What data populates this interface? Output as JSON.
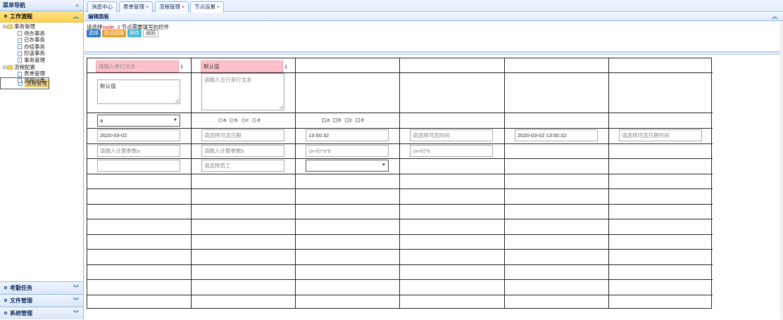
{
  "sidebar": {
    "title": "菜单导航",
    "collapse_icon": "double-chevron-left-icon",
    "active_section": "工作流程",
    "tree": [
      {
        "label": "事务管理",
        "type": "folder",
        "level": 0
      },
      {
        "label": "待办事务",
        "type": "file",
        "level": 1
      },
      {
        "label": "已办事务",
        "type": "file",
        "level": 1
      },
      {
        "label": "办结事务",
        "type": "file",
        "level": 1
      },
      {
        "label": "抄送事务",
        "type": "file",
        "level": 1
      },
      {
        "label": "事务管理",
        "type": "file",
        "level": 1
      },
      {
        "label": "流程配置",
        "type": "folder",
        "level": 0
      },
      {
        "label": "表单管理",
        "type": "file",
        "level": 1
      },
      {
        "label": "流程管理",
        "type": "file",
        "level": 1,
        "selected": true
      },
      {
        "label": "流程分类",
        "type": "file",
        "level": 1
      }
    ],
    "bottom_sections": [
      "考勤任务",
      "文件管理",
      "系统管理"
    ]
  },
  "tabs": [
    {
      "label": "消息中心",
      "closable": false
    },
    {
      "label": "表单管理",
      "closable": true
    },
    {
      "label": "流程管理",
      "closable": true
    },
    {
      "label": "节点设置",
      "closable": true,
      "active": true
    }
  ],
  "panel": {
    "title": "编辑面板",
    "hint_prefix": "请选择",
    "hint_node": "node_2",
    "hint_suffix": " 节点需要填写的控件",
    "buttons": {
      "select": "选择",
      "cancel": "取消选择",
      "save": "保存",
      "back": "返回"
    }
  },
  "form": {
    "row1": {
      "single_text": "请输入单行文本",
      "single_count": "1",
      "default_text": "默认值",
      "default_count": "1"
    },
    "row2": {
      "textarea_value": "默认值",
      "textarea_placeholder": "请输入五行多行文本"
    },
    "row3": {
      "select_value": "a",
      "radio_options": [
        "a",
        "b",
        "c",
        "d"
      ],
      "checkbox_options": [
        "a",
        "b",
        "c",
        "d"
      ]
    },
    "row4": {
      "date_value": "2020-03-02",
      "date_placeholder": "请选择可选日期",
      "time_value": "13:50:32",
      "time_placeholder": "请选择可选时间",
      "datetime_value": "2020-03-02 13:50:32",
      "datetime_placeholder": "请选择可选日期时间"
    },
    "row5": {
      "calc_a": "请输入计算参数a",
      "calc_b": "请输入计算参数b",
      "formula1": "(a+b)*a*b",
      "formula2": "(a+b)*b"
    },
    "row6": {
      "employee_placeholder": "请选择员工",
      "select_value": ""
    }
  }
}
